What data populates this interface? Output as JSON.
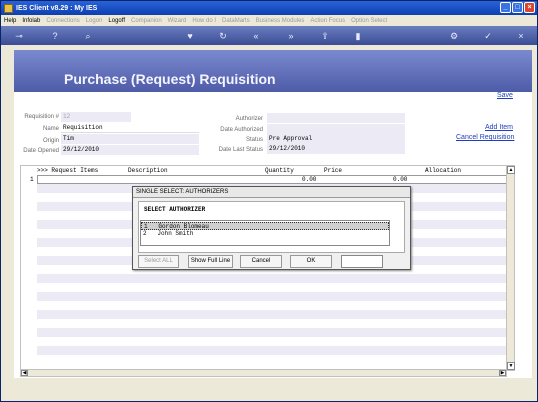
{
  "window": {
    "title": "IES Client v8.29 : My IES"
  },
  "menubar": [
    {
      "label": "Help",
      "enabled": true
    },
    {
      "label": "Infolab",
      "enabled": true
    },
    {
      "label": "Connections",
      "enabled": false
    },
    {
      "label": "Logon",
      "enabled": false
    },
    {
      "label": "Logoff",
      "enabled": true
    },
    {
      "label": "Companion",
      "enabled": false
    },
    {
      "label": "Wizard",
      "enabled": false
    },
    {
      "label": "How do I",
      "enabled": false
    },
    {
      "label": "DataMarts",
      "enabled": false
    },
    {
      "label": "Business Modules",
      "enabled": false
    },
    {
      "label": "Action Focus",
      "enabled": false
    },
    {
      "label": "Option Select",
      "enabled": false
    }
  ],
  "page": {
    "title": "Purchase (Request) Requisition",
    "save_label": "Save"
  },
  "form": {
    "requisition_no_label": "Requisition #",
    "requisition_no_value": "12",
    "name_label": "Name",
    "name_value": "Requisition",
    "origin_label": "Origin",
    "origin_value": "Tim",
    "date_opened_label": "Date Opened",
    "date_opened_value": "29/12/2010",
    "authorizer_label": "Authorizer",
    "authorizer_value": "",
    "date_authorized_label": "Date Authorized",
    "date_authorized_value": "",
    "status_label": "Status",
    "status_value": "Pre Approval",
    "date_last_status_label": "Date Last Status",
    "date_last_status_value": "29/12/2010"
  },
  "links": {
    "add_item": "Add Item",
    "cancel_requisition": "Cancel Requisition"
  },
  "grid": {
    "columns": [
      ">>> Request Items",
      "Description",
      "Quantity",
      "Price",
      "Allocation"
    ],
    "rows": [
      {
        "num": "1",
        "quantity": "0.00",
        "price": "0.00"
      }
    ]
  },
  "dialog": {
    "title": "SINGLE SELECT: AUTHORIZERS",
    "heading": "SELECT AUTHORIZER",
    "items": [
      {
        "num": "1",
        "name": "Gordon Blomeau",
        "selected": true
      },
      {
        "num": "2",
        "name": "John Smith",
        "selected": false
      }
    ],
    "buttons": {
      "select_all": "Select ALL",
      "show_full_line": "Show Full Line",
      "cancel": "Cancel",
      "ok": "OK"
    }
  },
  "colors": {
    "header_gradient_top": "#7b89cf",
    "header_gradient_bottom": "#4e5ca8",
    "link": "#1f3fbf"
  }
}
